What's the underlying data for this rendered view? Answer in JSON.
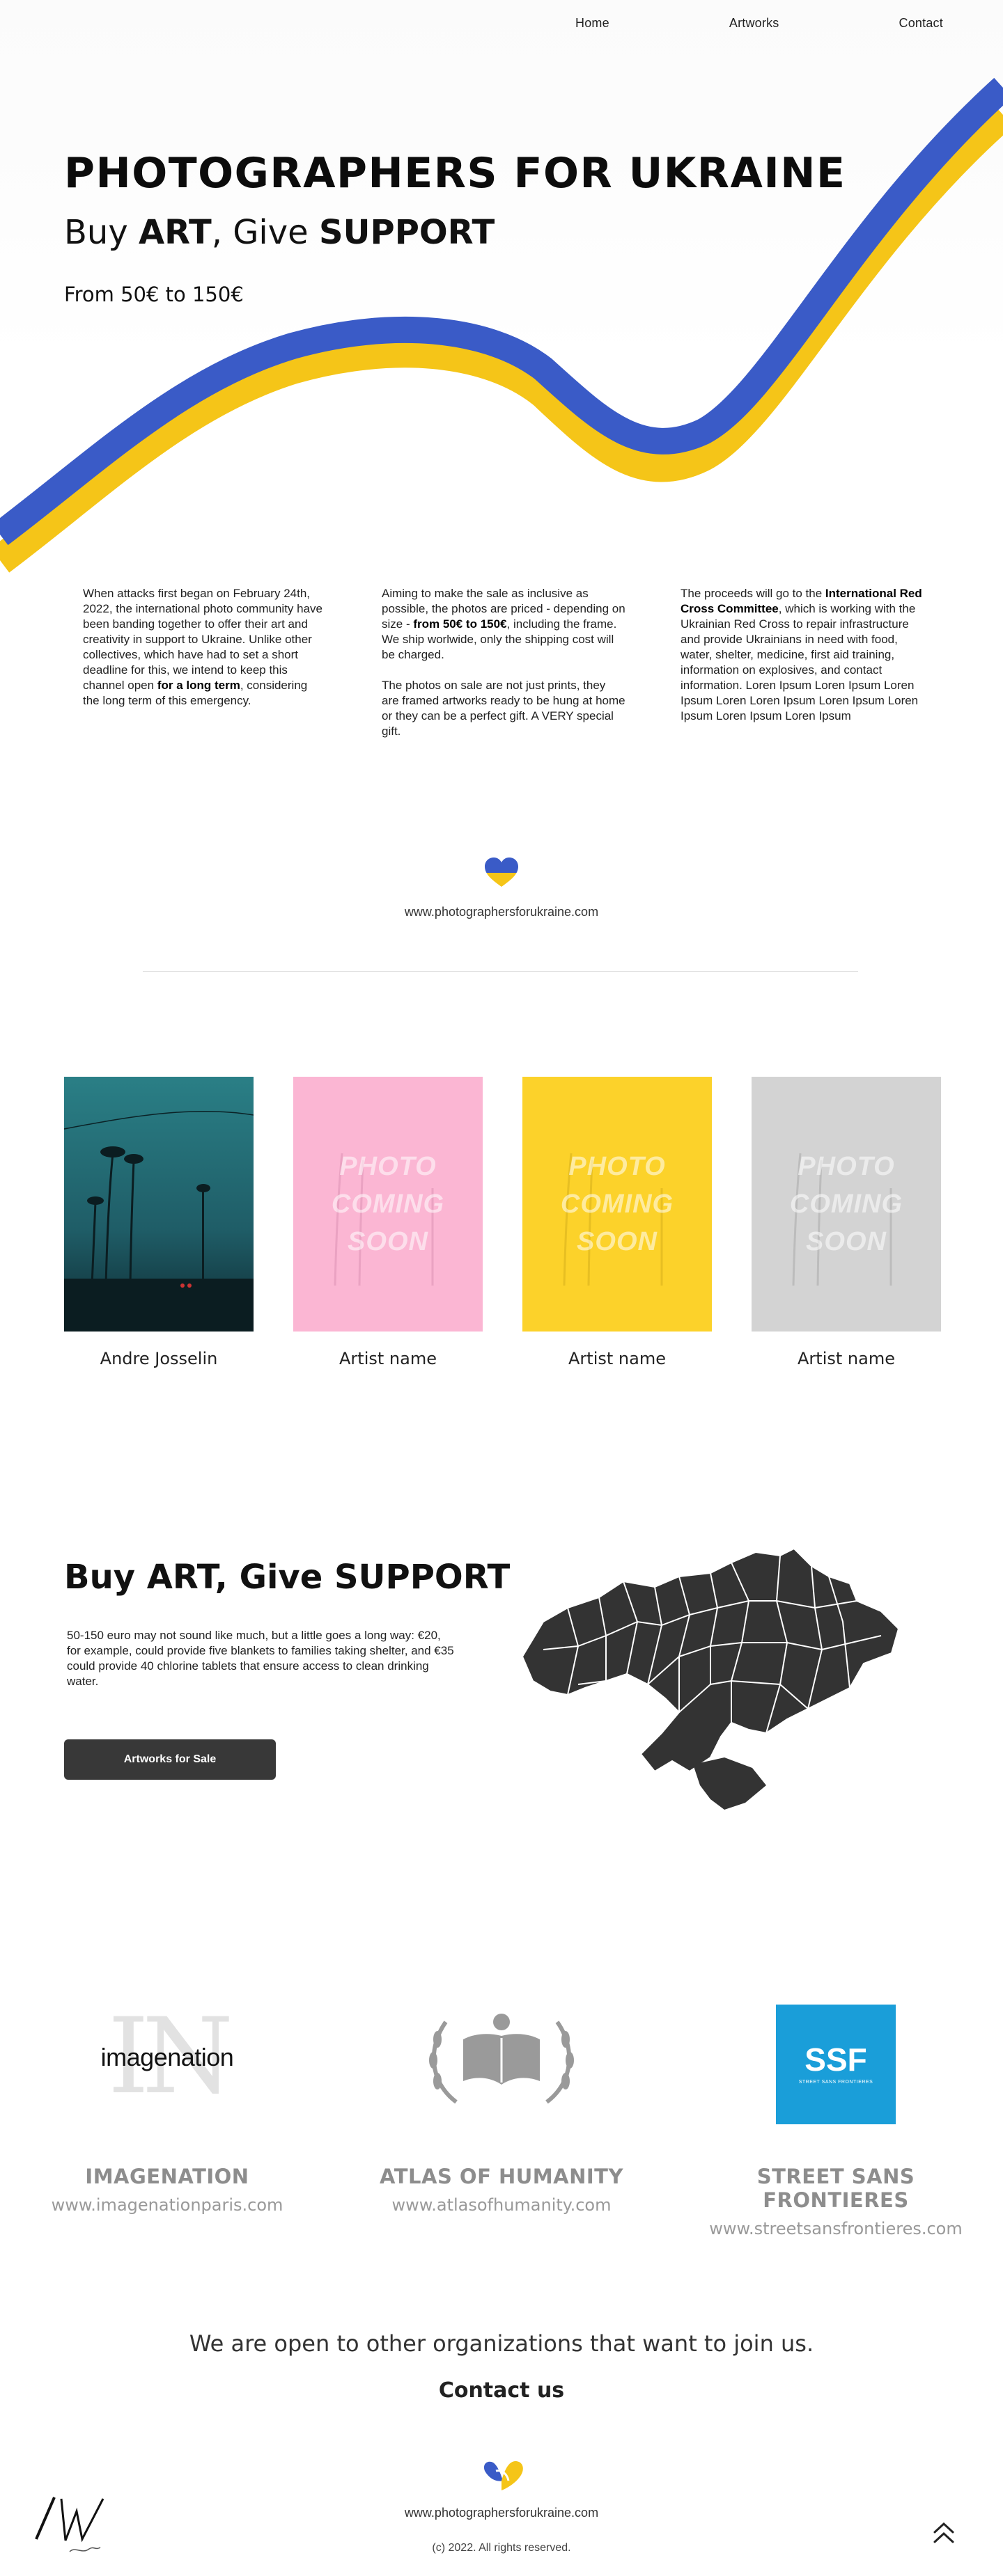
{
  "nav": {
    "home": "Home",
    "artworks": "Artworks",
    "contact": "Contact"
  },
  "hero": {
    "title": "PHOTOGRAPHERS FOR UKRAINE",
    "tag_pre": "Buy ",
    "tag_art": "ART",
    "tag_mid": ", Give ",
    "tag_support": "SUPPORT",
    "price": "From 50€ to 150€"
  },
  "intro": {
    "col1": {
      "text": "When attacks first began on February 24th, 2022, the international photo community have been banding together to offer their art and creativity in support to Ukraine. Unlike other collectives, which have had to set a short deadline for this, we intend to keep this channel open ",
      "bold": "for a long term",
      "tail": ", considering the long term of this emergency."
    },
    "col2": {
      "p1_pre": "Aiming to make the sale as inclusive as possible, the photos are priced - depending on size - ",
      "p1_bold": "from 50€ to 150€",
      "p1_post": ", including the frame. We ship worlwide, only the shipping cost will be charged.",
      "p2": "The photos on sale are not just prints, they are framed artworks ready to be hung at home or they can be a perfect gift. A VERY special gift."
    },
    "col3": {
      "pre": "The proceeds will go to the ",
      "bold": "International Red Cross Committee",
      "post": ", which is working with the Ukrainian Red Cross to repair infrastructure and provide Ukrainians in need with food, water, shelter, medicine, first aid training, information on explosives, and contact information. Loren Ipsum Loren Ipsum Loren Ipsum Loren Loren Ipsum Loren Ipsum Loren Ipsum Loren Ipsum Loren Ipsum"
    }
  },
  "site_url": "www.photographersforukraine.com",
  "artists": [
    {
      "name": "Andre Josselin",
      "placeholder": ""
    },
    {
      "name": "Artist name",
      "placeholder": "PHOTO COMING SOON"
    },
    {
      "name": "Artist name",
      "placeholder": "PHOTO COMING SOON"
    },
    {
      "name": "Artist name",
      "placeholder": "PHOTO COMING SOON"
    }
  ],
  "support": {
    "title_pre": "Buy ",
    "title_art": "ART",
    "title_mid": ", Give ",
    "title_support": "SUPPORT",
    "text": "50-150 euro may not sound like much, but a little goes a long way: €20, for example, could provide five blankets to families taking shelter, and €35 could provide 40 chlorine tablets that ensure access to clean drinking water.",
    "button": "Artworks for Sale"
  },
  "partners": [
    {
      "name": "IMAGENATION",
      "url": "www.imagenationparis.com",
      "logo_text": "imagenation",
      "logo_bg": "IN"
    },
    {
      "name": "ATLAS OF HUMANITY",
      "url": "www.atlasofhumanity.com"
    },
    {
      "name": "STREET SANS FRONTIERES",
      "url": "www.streetsansfrontieres.com",
      "logo_text": "SSF",
      "logo_sub": "STREET SANS FRONTIERES"
    }
  ],
  "open_text": "We are open to other organizations that want to join us.",
  "contact_us": "Contact us",
  "footer": {
    "url": "www.photographersforukraine.com",
    "copyright": "(c) 2022. All rights reserved."
  },
  "colors": {
    "blue": "#3a5bc7",
    "yellow": "#f5c518",
    "pink": "#fbb6d3",
    "dark": "#383838"
  }
}
